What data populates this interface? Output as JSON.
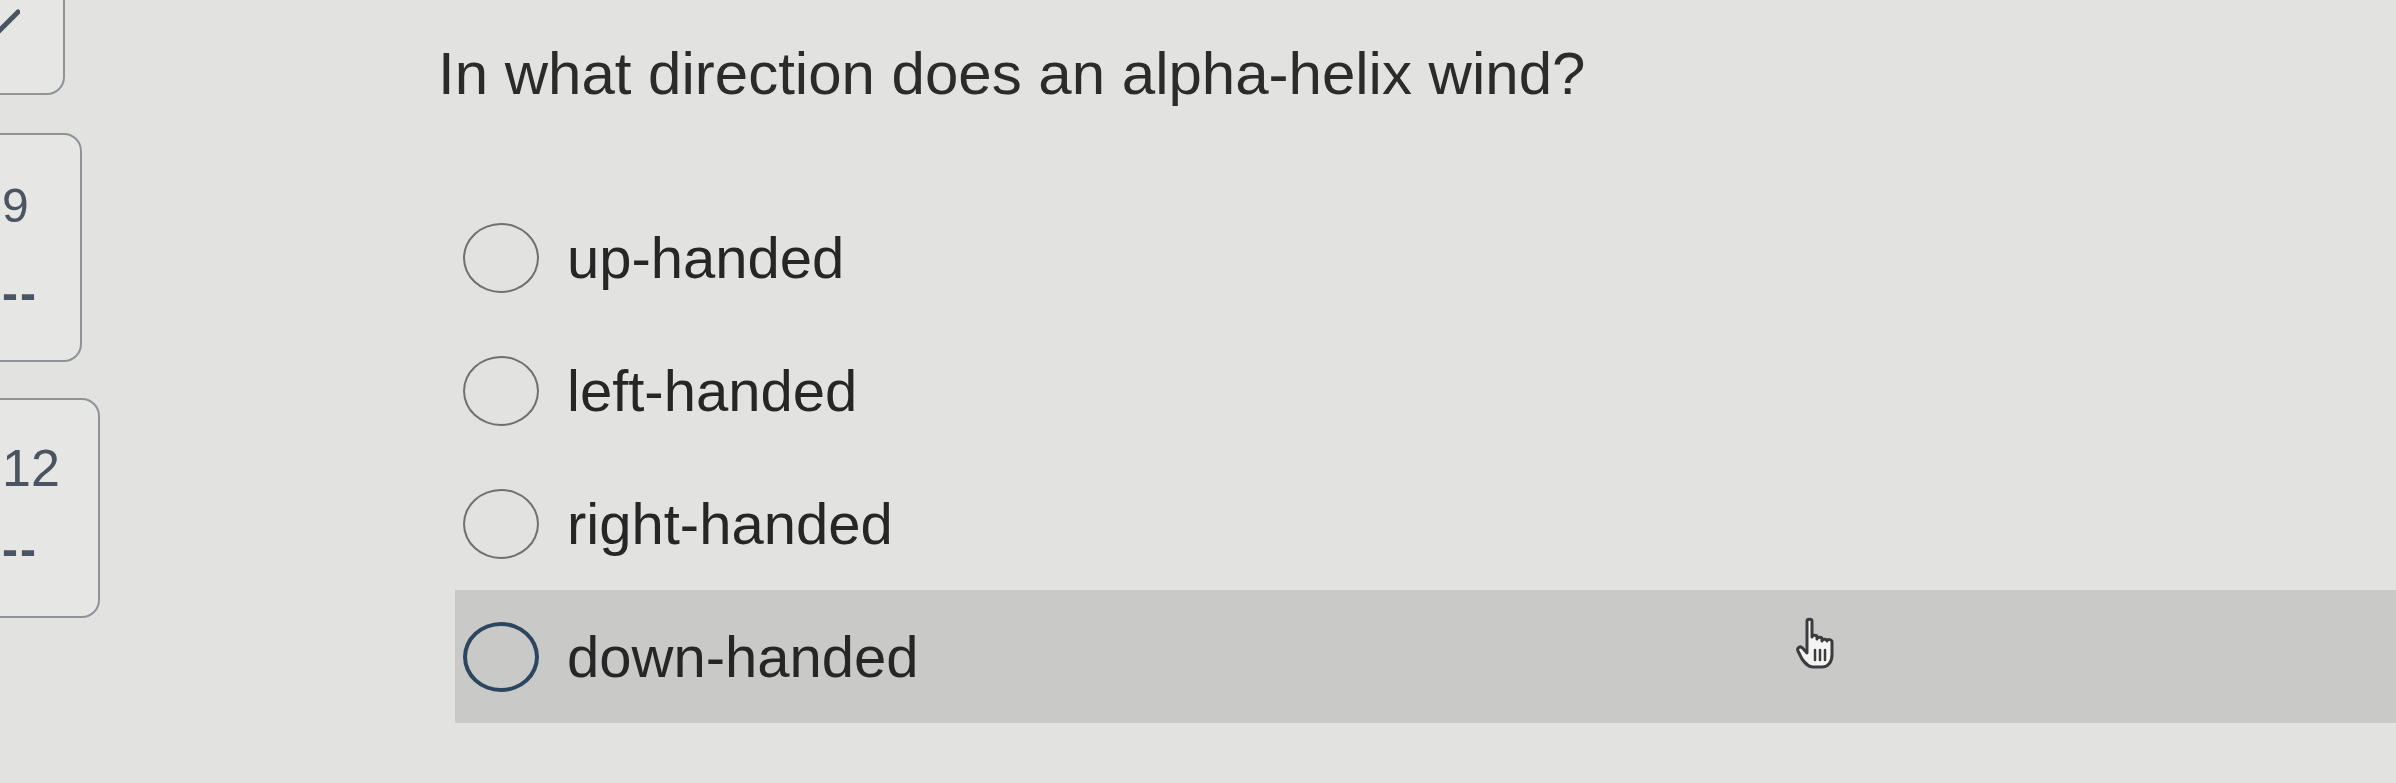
{
  "question_nav": [
    {
      "kind": "answered"
    },
    {
      "kind": "numbered",
      "number": "9",
      "status": "--"
    },
    {
      "kind": "numbered",
      "number": "12",
      "status": "--"
    }
  ],
  "question": {
    "text": "In what direction does an alpha-helix wind?",
    "options": [
      {
        "label": "up-handed",
        "selected": false,
        "hovered": false
      },
      {
        "label": "left-handed",
        "selected": false,
        "hovered": false
      },
      {
        "label": "right-handed",
        "selected": false,
        "hovered": false
      },
      {
        "label": "down-handed",
        "selected": false,
        "hovered": true
      }
    ]
  }
}
